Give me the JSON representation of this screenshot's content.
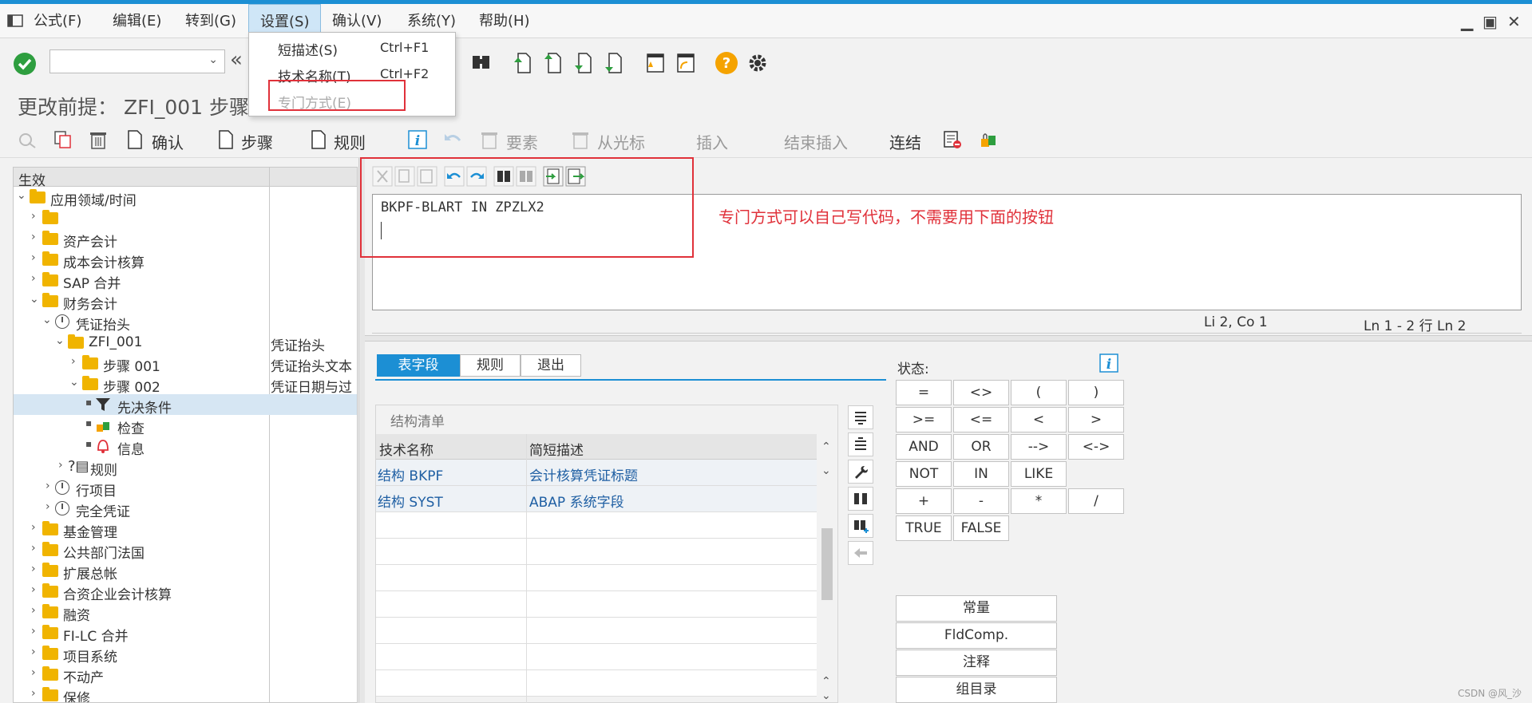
{
  "menubar": {
    "items": [
      "公式(F)",
      "编辑(E)",
      "转到(G)",
      "设置(S)",
      "确认(V)",
      "系统(Y)",
      "帮助(H)"
    ],
    "active_index": 3
  },
  "dropdown": {
    "items": [
      {
        "label": "短描述(S)",
        "shortcut": "Ctrl+F1"
      },
      {
        "label": "技术名称(T)",
        "shortcut": "Ctrl+F2"
      },
      {
        "label": "专门方式(E)",
        "shortcut": ""
      }
    ]
  },
  "title": "更改前提： ZFI_001 步骤",
  "toolbar2": {
    "confirm": "确认",
    "step": "步骤",
    "rule": "规则",
    "element": "要素",
    "from_cursor": "从光标",
    "insert": "插入",
    "end_insert": "结束插入",
    "link": "连结"
  },
  "tree": {
    "header": "生效",
    "nodes": [
      {
        "label": "应用领域/时间",
        "desc": ""
      },
      {
        "label": "",
        "desc": ""
      },
      {
        "label": "资产会计",
        "desc": ""
      },
      {
        "label": "成本会计核算",
        "desc": ""
      },
      {
        "label": "SAP 合并",
        "desc": ""
      },
      {
        "label": "财务会计",
        "desc": ""
      },
      {
        "label": "凭证抬头",
        "desc": ""
      },
      {
        "label": "ZFI_001",
        "desc": "凭证抬头"
      },
      {
        "label": "步骤 001",
        "desc": "凭证抬头文本"
      },
      {
        "label": "步骤 002",
        "desc": "凭证日期与过"
      },
      {
        "label": "先决条件",
        "desc": ""
      },
      {
        "label": "检查",
        "desc": ""
      },
      {
        "label": "信息",
        "desc": ""
      },
      {
        "label": "规则",
        "desc": ""
      },
      {
        "label": "行项目",
        "desc": ""
      },
      {
        "label": "完全凭证",
        "desc": ""
      },
      {
        "label": "基金管理",
        "desc": ""
      },
      {
        "label": "公共部门法国",
        "desc": ""
      },
      {
        "label": "扩展总帐",
        "desc": ""
      },
      {
        "label": "合资企业会计核算",
        "desc": ""
      },
      {
        "label": "融资",
        "desc": ""
      },
      {
        "label": "FI-LC 合并",
        "desc": ""
      },
      {
        "label": "项目系统",
        "desc": ""
      },
      {
        "label": "不动产",
        "desc": ""
      },
      {
        "label": "保修",
        "desc": ""
      }
    ]
  },
  "editor": {
    "code": "BKPF-BLART IN ZPZLX2",
    "annotation": "专门方式可以自己写代码，不需要用下面的按钮",
    "position": "Li 2, Co 1",
    "lines": "Ln 1 - 2 行 Ln 2"
  },
  "tabs": [
    "表字段",
    "规则",
    "退出"
  ],
  "structure": {
    "title": "结构清单",
    "columns": [
      "技术名称",
      "简短描述"
    ],
    "rows": [
      {
        "name": "结构 BKPF",
        "desc": "会计核算凭证标题"
      },
      {
        "name": "结构 SYST",
        "desc": "ABAP 系统字段"
      }
    ]
  },
  "operators": {
    "status_label": "状态:",
    "buttons": [
      "=",
      "<>",
      "(",
      ")",
      ">=",
      "<=",
      "<",
      ">",
      "AND",
      "OR",
      "-->",
      "<->",
      "NOT",
      "IN",
      "LIKE",
      "+",
      "-",
      "*",
      "/",
      "TRUE",
      "FALSE"
    ],
    "wide": [
      "常量",
      "FldComp.",
      "注释",
      "组目录"
    ]
  },
  "watermark": "CSDN @风_沙",
  "colors": {
    "accent": "#1c8fd4",
    "annotation_red": "#e0313a",
    "folder": "#f0b400",
    "ok_green": "#2e9e3f",
    "help_orange": "#f5a300"
  }
}
